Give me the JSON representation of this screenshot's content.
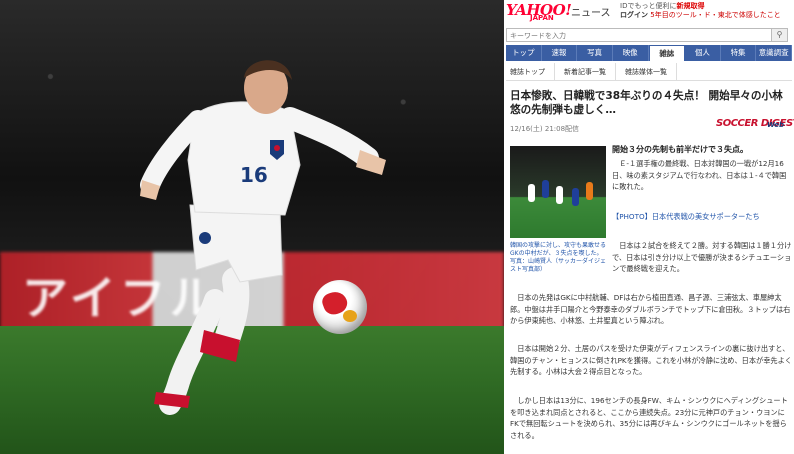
{
  "photo": {
    "ad_text": "アイフル",
    "jersey_number": "16"
  },
  "header": {
    "logo": "YAHOO!",
    "logo_sub": "JAPAN",
    "section": "ニュース",
    "info_line1_pre": "IDでもっと便利に",
    "info_line1_link": "新規取得",
    "info_login": "ログイン",
    "info_line2": "5年目のツール・ド・東北で体感したこと"
  },
  "search": {
    "placeholder": "キーワードを入力",
    "icon": "search-icon"
  },
  "nav": {
    "items": [
      "トップ",
      "速報",
      "写真",
      "映像",
      "雑誌",
      "個人",
      "特集",
      "意識調査"
    ],
    "active_index": 4
  },
  "subnav": {
    "items": [
      "雑誌トップ",
      "新着記事一覧",
      "雑誌媒体一覧"
    ]
  },
  "article": {
    "title": "日本惨敗、日韓戦で38年ぶりの４失点！ 開始早々の小林悠の先制弾も虚しく…",
    "date": "12/16(土) 21:08配信",
    "brand": "SOCCER DIGEST",
    "brand_sub": "Web",
    "thumb_caption": "韓国の攻撃に対し、攻守も果敢せるGKの中村だが、３失点を喫した。写真：山崎賢人（サッカーダイジェスト写真部）",
    "lead": "開始３分の先制も前半だけで３失点。",
    "para1": "　Ｅ-１選手権の最終戦、日本対韓国の一戦が12月16日、味の素スタジアムで行なわれ、日本は１-４で韓国に敗れた。",
    "photo_link": "【PHOTO】日本代表戦の美女サポーターたち",
    "para2": "　日本は２試合を終えて２勝。対する韓国は１勝１分けで、日本は引き分け以上で優勝が決まるシチュエーションで最終戦を迎えた。",
    "para3": "　日本の先発はGKに中村航輔、DFは右から植田直通、昌子源、三浦弦太、車屋紳太郎。中盤は井手口陽介と今野泰幸のダブルボランチでトップ下に倉田秋。３トップは右から伊東純也、小林悠、土井聖真という陣ぶれ。",
    "para4": "　日本は開始２分、土居のパスを受けた伊東がディフェンスラインの裏に抜け出すと、韓国のチャン・ヒョンスに倒されPKを獲得。これを小林が冷静に沈め、日本が幸先よく先制する。小林は大会２得点目となった。",
    "para5": "　しかし日本は13分に、196センチの長身FW、キム・シンウクにヘディングシュートを叩き込まれ同点とされると、ここから連続失点。23分に元神戸のチョン・ウヨンにFKで無回転シュートを決められ、35分には再びキム・シンウクにゴールネットを揺らされる。"
  }
}
